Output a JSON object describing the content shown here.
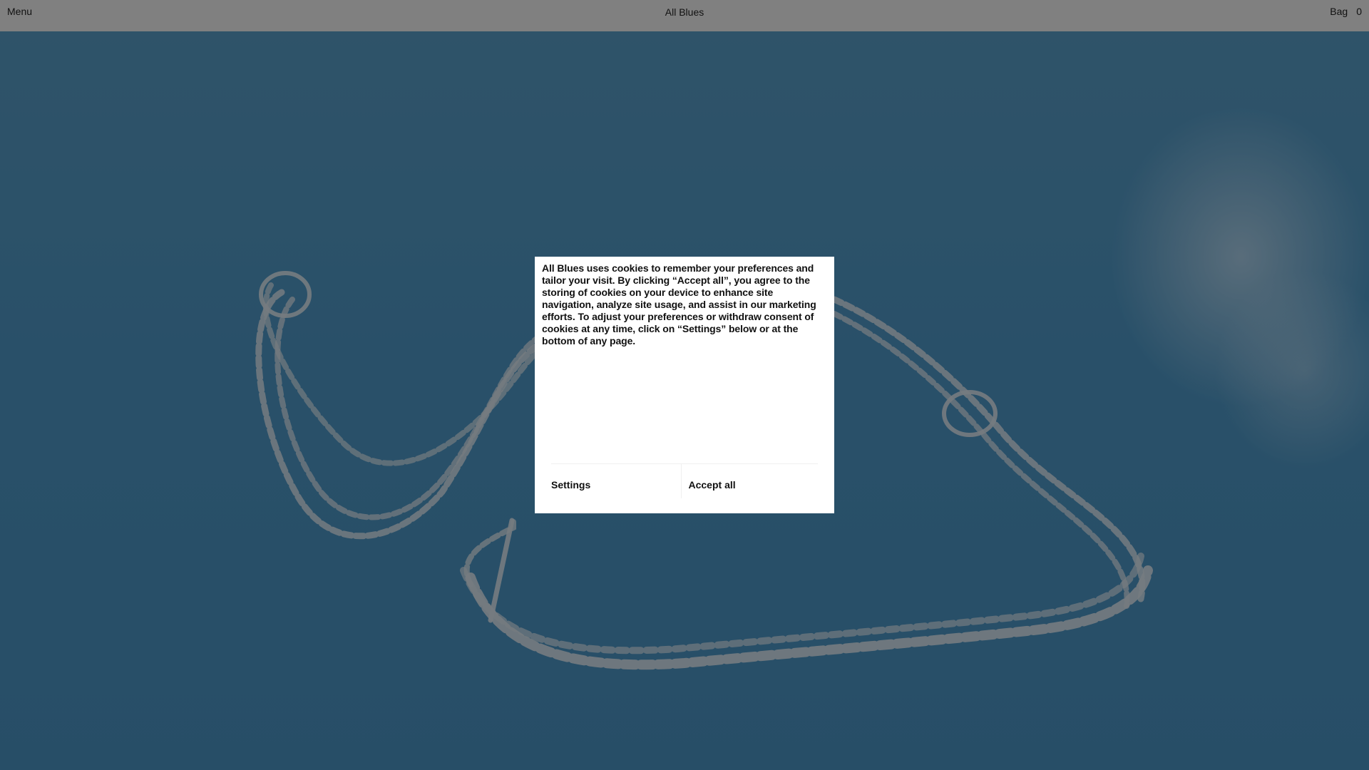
{
  "header": {
    "menu_label": "Menu",
    "brand": "All Blues",
    "bag_label": "Bag",
    "bag_count": "0"
  },
  "cookie_banner": {
    "message": "All Blues uses cookies to remember your preferences and tailor your visit. By clicking “Accept all”, you agree to the storing of cookies on your device to enhance site navigation, analyze site usage, and assist in our marketing efforts. To adjust your preferences or withdraw consent of cookies at any time, click on “Settings” below or at the bottom of any page.",
    "settings_label": "Settings",
    "accept_label": "Accept all"
  },
  "colors": {
    "topbar_bg": "#808080",
    "sky_blue": "#2f76a3",
    "modal_bg": "#ffffff",
    "text": "#111111"
  }
}
